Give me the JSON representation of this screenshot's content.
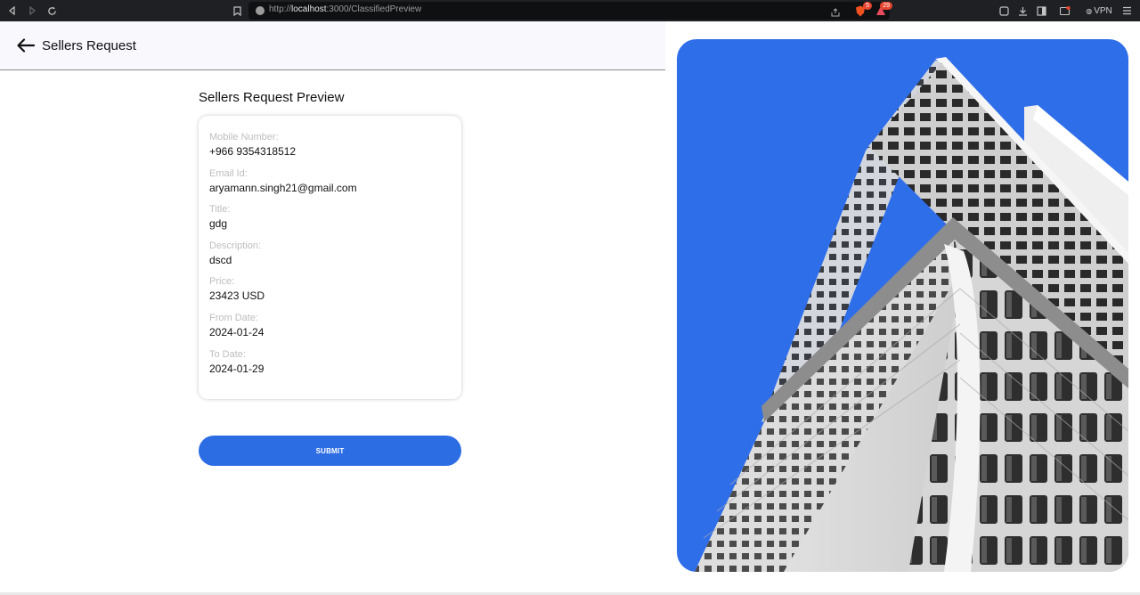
{
  "browser": {
    "url_prefix": "http://",
    "url_host": "localhost",
    "url_rest": ":3000/ClassifiedPreview",
    "vpn_label": "VPN",
    "shield_count": "5",
    "alert_count": "29"
  },
  "header": {
    "title": "Sellers Request"
  },
  "preview": {
    "title": "Sellers Request Preview",
    "fields": [
      {
        "label": "Mobile Number:",
        "value": "+966 9354318512"
      },
      {
        "label": "Email Id:",
        "value": "aryamann.singh21@gmail.com"
      },
      {
        "label": "Title:",
        "value": "gdg"
      },
      {
        "label": "Description:",
        "value": "dscd"
      },
      {
        "label": "Price:",
        "value": "23423 USD"
      },
      {
        "label": "From Date:",
        "value": "2024-01-24"
      },
      {
        "label": "To Date:",
        "value": "2024-01-29"
      }
    ],
    "submit_label": "SUBMIT"
  },
  "colors": {
    "accent": "#2d6de4",
    "hero_sky": "#2f6ee9"
  }
}
